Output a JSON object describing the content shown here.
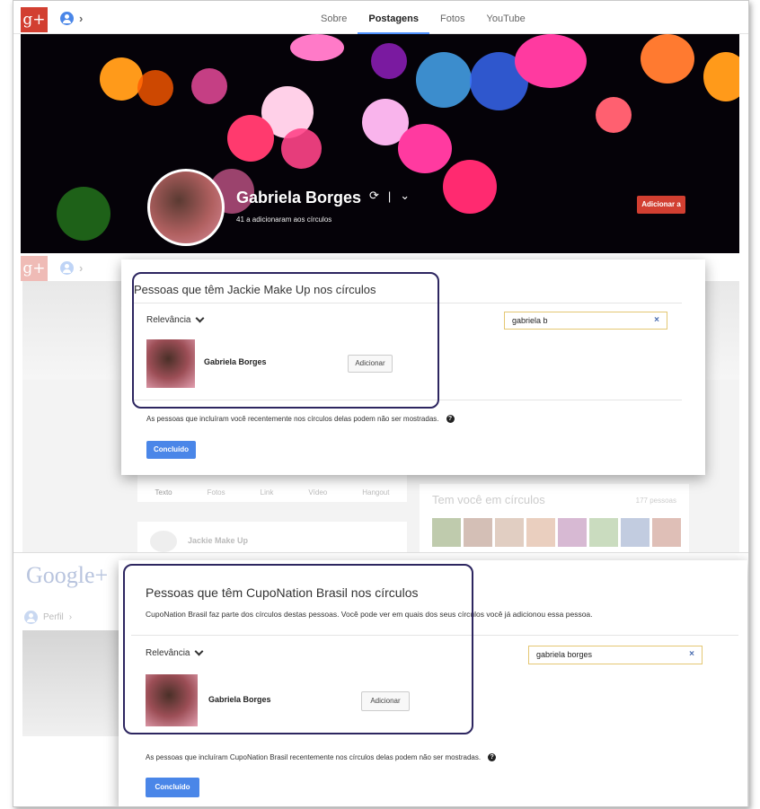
{
  "panel1": {
    "logo": "g+",
    "tabs": [
      "Sobre",
      "Postagens",
      "Fotos",
      "YouTube"
    ],
    "active_tab": "Postagens",
    "profile_name": "Gabriela Borges",
    "circles_count": "41 a adicionaram aos círculos",
    "add_button": "Adicionar a"
  },
  "panel2": {
    "logo": "g+",
    "dialog_title": "Pessoas que têm Jackie Make Up nos círculos",
    "sort_label": "Relevância",
    "search_value": "gabriela b",
    "result_name": "Gabriela Borges",
    "result_button": "Adicionar",
    "note": "As pessoas que incluíram você recentemente nos círculos delas podem não ser mostradas.",
    "done_button": "Concluído",
    "bg_actions": [
      "Texto",
      "Fotos",
      "Link",
      "Vídeo",
      "Hangout"
    ],
    "bg_card_title": "Tem você em círculos",
    "bg_card_count": "177 pessoas",
    "bg_post_name": "Jackie Make Up"
  },
  "panel3": {
    "logo": "Google+",
    "nav_label": "Perfil",
    "dialog_title": "Pessoas que têm CupoNation Brasil nos círculos",
    "dialog_subtitle": "CupoNation Brasil faz parte dos círculos destas pessoas. Você pode ver em quais dos seus círculos você já adicionou essa pessoa.",
    "sort_label": "Relevância",
    "search_value": "gabriela borges",
    "result_name": "Gabriela Borges",
    "result_button": "Adicionar",
    "note": "As pessoas que incluíram CupoNation Brasil recentemente nos círculos delas podem não ser mostradas.",
    "done_button": "Concluído"
  },
  "icons": {
    "clear": "×",
    "help": "?",
    "chevron": "›"
  },
  "colors": {
    "gplus_red": "#d23f31",
    "primary_blue": "#4a86e8",
    "highlight_outline": "#2d2660"
  }
}
